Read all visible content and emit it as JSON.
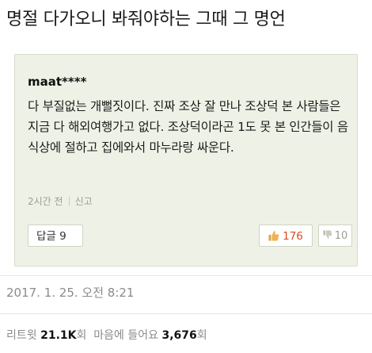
{
  "post_title": "명절 다가오니 봐줘야하는 그때 그 명언",
  "comment": {
    "username": "maat****",
    "text": "다 부질없는 개뻘짓이다. 진짜 조상 잘 만나 조상덕 본 사람들은 지금 다 해외여행가고 없다. 조상덕이라곤 1도 못 본 인간들이 음식상에 절하고 집에와서 마누라랑 싸운다.",
    "time_ago": "2시간 전",
    "report_label": "신고",
    "reply_label": "답글",
    "reply_count": "9",
    "likes": "176",
    "dislikes": "10",
    "like_color": "#d94a1e"
  },
  "tweet": {
    "timestamp": "2017. 1. 25. 오전 8:21",
    "retweet_label": "리트윗",
    "retweet_count": "21.1K",
    "retweet_unit": "회",
    "like_label": "마음에 들어요",
    "like_count": "3,676",
    "like_unit": "회"
  }
}
